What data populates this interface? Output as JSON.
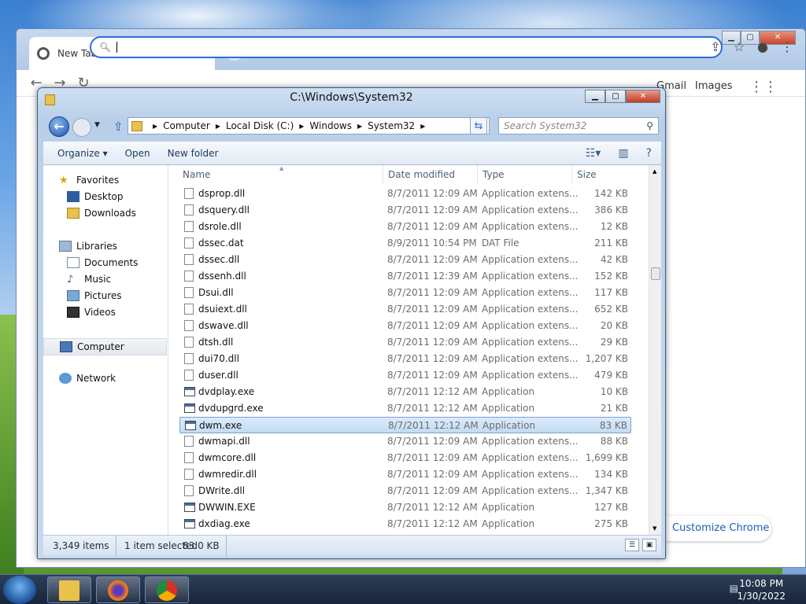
{
  "chrome": {
    "tab_title": "New Tab",
    "tab_close": "✕",
    "new_tab": "+",
    "gmail": "Gmail",
    "images": "Images",
    "customize": "Customize Chrome"
  },
  "explorer": {
    "title": "C:\\Windows\\System32",
    "breadcrumb": [
      "Computer",
      "Local Disk (C:)",
      "Windows",
      "System32"
    ],
    "search_placeholder": "Search System32",
    "commands": {
      "organize": "Organize ▾",
      "open": "Open",
      "new_folder": "New folder"
    },
    "nav": {
      "favorites": "Favorites",
      "desktop": "Desktop",
      "downloads": "Downloads",
      "libraries": "Libraries",
      "documents": "Documents",
      "music": "Music",
      "pictures": "Pictures",
      "videos": "Videos",
      "computer": "Computer",
      "network": "Network"
    },
    "columns": {
      "name": "Name",
      "date": "Date modified",
      "type": "Type",
      "size": "Size"
    },
    "files": [
      {
        "name": "dsprop.dll",
        "date": "8/7/2011 12:09 AM",
        "type": "Application extens...",
        "size": "142 KB",
        "kind": "dll"
      },
      {
        "name": "dsquery.dll",
        "date": "8/7/2011 12:09 AM",
        "type": "Application extens...",
        "size": "386 KB",
        "kind": "dll"
      },
      {
        "name": "dsrole.dll",
        "date": "8/7/2011 12:09 AM",
        "type": "Application extens...",
        "size": "12 KB",
        "kind": "dll"
      },
      {
        "name": "dssec.dat",
        "date": "8/9/2011 10:54 PM",
        "type": "DAT File",
        "size": "211 KB",
        "kind": "dat"
      },
      {
        "name": "dssec.dll",
        "date": "8/7/2011 12:09 AM",
        "type": "Application extens...",
        "size": "42 KB",
        "kind": "dll"
      },
      {
        "name": "dssenh.dll",
        "date": "8/7/2011 12:39 AM",
        "type": "Application extens...",
        "size": "152 KB",
        "kind": "dll"
      },
      {
        "name": "Dsui.dll",
        "date": "8/7/2011 12:09 AM",
        "type": "Application extens...",
        "size": "117 KB",
        "kind": "dll"
      },
      {
        "name": "dsuiext.dll",
        "date": "8/7/2011 12:09 AM",
        "type": "Application extens...",
        "size": "652 KB",
        "kind": "dll"
      },
      {
        "name": "dswave.dll",
        "date": "8/7/2011 12:09 AM",
        "type": "Application extens...",
        "size": "20 KB",
        "kind": "dll"
      },
      {
        "name": "dtsh.dll",
        "date": "8/7/2011 12:09 AM",
        "type": "Application extens...",
        "size": "29 KB",
        "kind": "dll"
      },
      {
        "name": "dui70.dll",
        "date": "8/7/2011 12:09 AM",
        "type": "Application extens...",
        "size": "1,207 KB",
        "kind": "dll"
      },
      {
        "name": "duser.dll",
        "date": "8/7/2011 12:09 AM",
        "type": "Application extens...",
        "size": "479 KB",
        "kind": "dll"
      },
      {
        "name": "dvdplay.exe",
        "date": "8/7/2011 12:12 AM",
        "type": "Application",
        "size": "10 KB",
        "kind": "exe"
      },
      {
        "name": "dvdupgrd.exe",
        "date": "8/7/2011 12:12 AM",
        "type": "Application",
        "size": "21 KB",
        "kind": "exe"
      },
      {
        "name": "dwm.exe",
        "date": "8/7/2011 12:12 AM",
        "type": "Application",
        "size": "83 KB",
        "kind": "exe",
        "selected": true
      },
      {
        "name": "dwmapi.dll",
        "date": "8/7/2011 12:09 AM",
        "type": "Application extens...",
        "size": "88 KB",
        "kind": "dll"
      },
      {
        "name": "dwmcore.dll",
        "date": "8/7/2011 12:09 AM",
        "type": "Application extens...",
        "size": "1,699 KB",
        "kind": "dll"
      },
      {
        "name": "dwmredir.dll",
        "date": "8/7/2011 12:09 AM",
        "type": "Application extens...",
        "size": "134 KB",
        "kind": "dll"
      },
      {
        "name": "DWrite.dll",
        "date": "8/7/2011 12:09 AM",
        "type": "Application extens...",
        "size": "1,347 KB",
        "kind": "dll"
      },
      {
        "name": "DWWIN.EXE",
        "date": "8/7/2011 12:12 AM",
        "type": "Application",
        "size": "127 KB",
        "kind": "exe"
      },
      {
        "name": "dxdiag.exe",
        "date": "8/7/2011 12:12 AM",
        "type": "Application",
        "size": "275 KB",
        "kind": "exe"
      }
    ],
    "status": {
      "count": "3,349 items",
      "selected": "1 item selected",
      "size": "83.0 KB"
    }
  },
  "taskbar": {
    "time": "10:08 PM",
    "date": "1/30/2022"
  }
}
